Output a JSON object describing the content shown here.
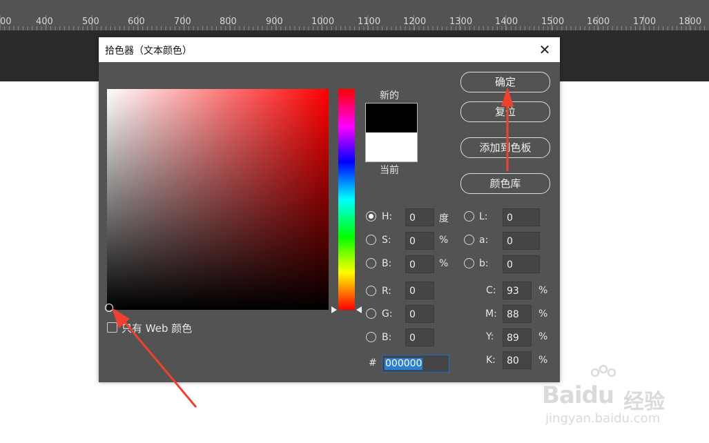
{
  "ruler": {
    "ticks": [
      "00",
      "400",
      "500",
      "600",
      "700",
      "800",
      "900",
      "1000",
      "1100",
      "1200",
      "1300",
      "1400",
      "1500",
      "1600",
      "1700",
      "1800"
    ]
  },
  "dialog": {
    "title": "拾色器（文本颜色）",
    "close_icon": "close-icon",
    "new_label": "新的",
    "current_label": "当前",
    "new_color": "#000000",
    "current_color": "#ffffff",
    "buttons": {
      "ok": "确定",
      "reset": "复位",
      "add_swatch": "添加到色板",
      "color_library": "颜色库"
    },
    "web_only_label": "只有 Web 颜色",
    "fields": {
      "H": {
        "label": "H:",
        "value": "0",
        "unit": "度"
      },
      "S": {
        "label": "S:",
        "value": "0",
        "unit": "%"
      },
      "Bhsb": {
        "label": "B:",
        "value": "0",
        "unit": "%"
      },
      "R": {
        "label": "R:",
        "value": "0"
      },
      "G": {
        "label": "G:",
        "value": "0"
      },
      "Brgb": {
        "label": "B:",
        "value": "0"
      },
      "L": {
        "label": "L:",
        "value": "0"
      },
      "a": {
        "label": "a:",
        "value": "0"
      },
      "b": {
        "label": "b:",
        "value": "0"
      },
      "C": {
        "label": "C:",
        "value": "93",
        "unit": "%"
      },
      "M": {
        "label": "M:",
        "value": "88",
        "unit": "%"
      },
      "Y": {
        "label": "Y:",
        "value": "89",
        "unit": "%"
      },
      "K": {
        "label": "K:",
        "value": "80",
        "unit": "%"
      }
    },
    "hex": {
      "prefix": "#",
      "value": "000000"
    },
    "hue_position": 0
  },
  "watermark": {
    "brand": "Baidu",
    "cn": "经验",
    "url": "jingyan.baidu.com"
  },
  "colors": {
    "dialog_bg": "#535353",
    "arrow": "#f2402f",
    "selection": "#2d7fd6"
  }
}
